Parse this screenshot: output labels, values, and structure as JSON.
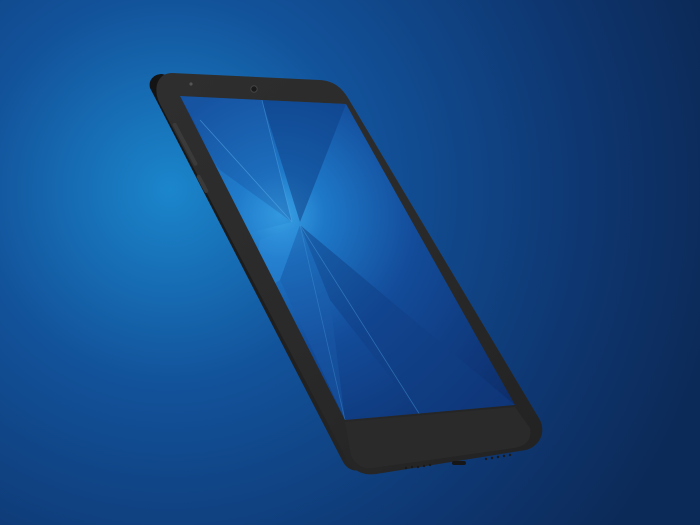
{
  "scene": {
    "subject": "smartphone-mockup",
    "colors": {
      "background_glow": "#1b7fc4",
      "background_mid": "#104a8d",
      "background_edge": "#0c2a58",
      "device_body": "#2c2c2c",
      "device_edge": "#1c1c1c",
      "screen_glow": "#2a8fd8",
      "screen_dark": "#0d2b66"
    }
  }
}
